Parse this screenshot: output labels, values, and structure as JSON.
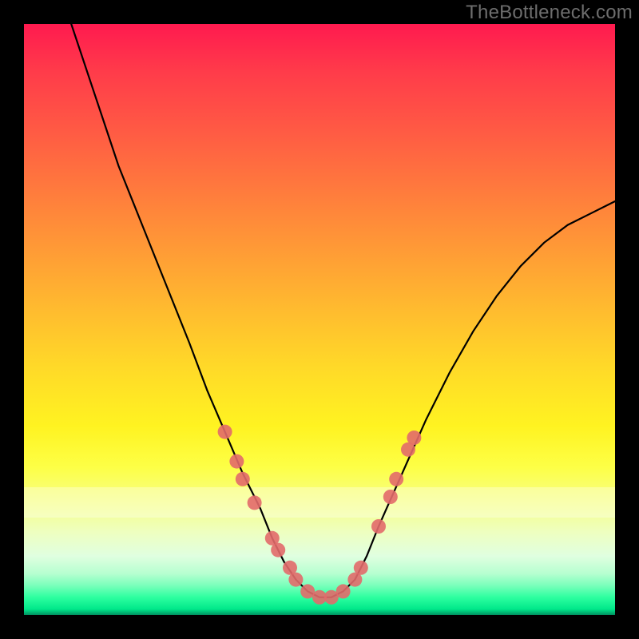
{
  "watermark": "TheBottleneck.com",
  "chart_data": {
    "type": "line",
    "title": "",
    "xlabel": "",
    "ylabel": "",
    "xlim": [
      0,
      100
    ],
    "ylim": [
      0,
      100
    ],
    "curve": {
      "name": "bottleneck-curve",
      "x": [
        8,
        12,
        16,
        20,
        24,
        28,
        31,
        34,
        37,
        40,
        42,
        44,
        46,
        48,
        50,
        52,
        54,
        56,
        58,
        60,
        64,
        68,
        72,
        76,
        80,
        84,
        88,
        92,
        96,
        100
      ],
      "y": [
        100,
        88,
        76,
        66,
        56,
        46,
        38,
        31,
        24,
        18,
        13,
        9,
        6,
        4,
        3,
        3,
        4,
        6,
        10,
        15,
        24,
        33,
        41,
        48,
        54,
        59,
        63,
        66,
        68,
        70
      ]
    },
    "markers": {
      "name": "sample-points",
      "color": "#e26a6a",
      "points": [
        {
          "x": 34,
          "y": 31
        },
        {
          "x": 36,
          "y": 26
        },
        {
          "x": 37,
          "y": 23
        },
        {
          "x": 39,
          "y": 19
        },
        {
          "x": 42,
          "y": 13
        },
        {
          "x": 43,
          "y": 11
        },
        {
          "x": 45,
          "y": 8
        },
        {
          "x": 46,
          "y": 6
        },
        {
          "x": 48,
          "y": 4
        },
        {
          "x": 50,
          "y": 3
        },
        {
          "x": 52,
          "y": 3
        },
        {
          "x": 54,
          "y": 4
        },
        {
          "x": 56,
          "y": 6
        },
        {
          "x": 57,
          "y": 8
        },
        {
          "x": 60,
          "y": 15
        },
        {
          "x": 62,
          "y": 20
        },
        {
          "x": 63,
          "y": 23
        },
        {
          "x": 65,
          "y": 28
        },
        {
          "x": 66,
          "y": 30
        }
      ]
    },
    "gradient_colormap": "RdYlGn_inverted_vertical"
  }
}
